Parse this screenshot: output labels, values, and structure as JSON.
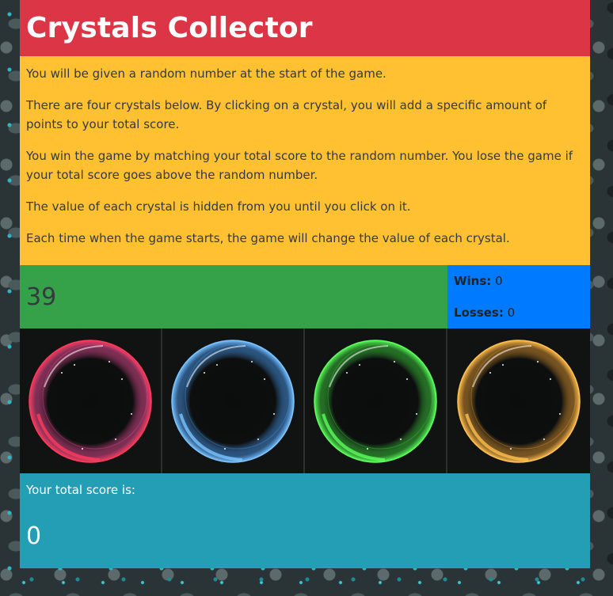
{
  "header": {
    "title": "Crystals Collector"
  },
  "instructions": [
    "You will be given a random number at the start of the game.",
    "There are four crystals below. By clicking on a crystal, you will add a specific amount of points to your total score.",
    "You win the game by matching your total score to the random number. You lose the game if your total score goes above the random number.",
    "The value of each crystal is hidden from you until you click on it.",
    "Each time when the game starts, the game will change the value of each crystal."
  ],
  "target": {
    "value": "39"
  },
  "record": {
    "wins_label": "Wins:",
    "wins_value": "0",
    "losses_label": "Losses:",
    "losses_value": "0"
  },
  "crystals": [
    {
      "name": "pink-crystal",
      "color": "#ff4fa0",
      "accent": "#ff3b5c"
    },
    {
      "name": "blue-crystal",
      "color": "#4aa3ff",
      "accent": "#7cc4ff"
    },
    {
      "name": "green-crystal",
      "color": "#3ddc3d",
      "accent": "#5cff5c"
    },
    {
      "name": "orange-crystal",
      "color": "#f0a030",
      "accent": "#ffc050"
    }
  ],
  "total": {
    "label": "Your total score is:",
    "value": "0"
  },
  "colors": {
    "header": "#dc3545",
    "instructions": "#ffc132",
    "target": "#35a24a",
    "record": "#007bff",
    "total": "#239eb5"
  }
}
